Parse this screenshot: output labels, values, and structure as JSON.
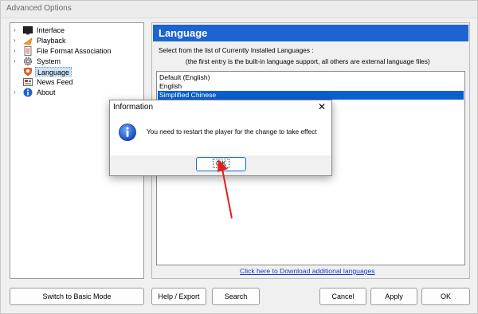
{
  "window": {
    "title": "Advanced Options"
  },
  "tree": {
    "items": [
      {
        "label": "Interface",
        "icon": "monitor-icon"
      },
      {
        "label": "Playback",
        "icon": "play-icon"
      },
      {
        "label": "File Format Association",
        "icon": "file-icon"
      },
      {
        "label": "System",
        "icon": "gear-icon"
      },
      {
        "label": "Language",
        "icon": "language-icon",
        "selected": true
      },
      {
        "label": "News Feed",
        "icon": "news-icon"
      },
      {
        "label": "About",
        "icon": "info-icon"
      }
    ]
  },
  "panel": {
    "header": "Language",
    "note1": "Select from the list of Currently Installed Languages :",
    "note2": "(the first entry is the built-in language support, all others are external language files)",
    "languages": [
      "Default (English)",
      "English",
      "Simplified Chinese"
    ],
    "selected_language": "Simplified Chinese",
    "download_link": "Click here to Download additional languages"
  },
  "buttons": {
    "basic_mode": "Switch to Basic Mode",
    "help_export": "Help / Export",
    "search": "Search",
    "cancel": "Cancel",
    "apply": "Apply",
    "ok": "OK"
  },
  "dialog": {
    "title": "Information",
    "message": "You need to restart the player for the change to take effect",
    "ok": "OK"
  },
  "colors": {
    "accent": "#1c64d1",
    "selection": "#0a60d0",
    "annotation_arrow": "#e02020"
  }
}
